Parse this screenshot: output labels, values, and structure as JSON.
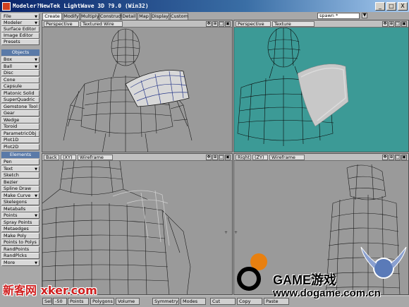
{
  "window": {
    "title": "Modeler?NewTek LightWave 3D ?9.0 (Win32)",
    "controls": [
      "_",
      "□",
      "X"
    ]
  },
  "left_panel": {
    "top_items": [
      {
        "label": "File",
        "dropdown": true
      },
      {
        "label": "Modeler",
        "dropdown": true
      },
      {
        "label": "Surface Editor"
      },
      {
        "label": "Image Editor"
      },
      {
        "label": "Presets"
      }
    ],
    "objects_header": "Objects",
    "objects": [
      {
        "label": "Box",
        "dropdown": true
      },
      {
        "label": "Ball",
        "dropdown": true
      },
      {
        "label": "Disc"
      },
      {
        "label": "Cone"
      },
      {
        "label": "Capsule"
      },
      {
        "label": "Platonic Solid"
      },
      {
        "label": "SuperQuadric"
      },
      {
        "label": "Gemstone Tool"
      },
      {
        "label": "Gear"
      },
      {
        "label": "Wedge"
      },
      {
        "label": "Toroid"
      },
      {
        "label": "ParametricObj"
      },
      {
        "label": "Plot1D"
      },
      {
        "label": "Plot2D"
      }
    ],
    "elements_header": "Elements",
    "elements": [
      {
        "label": "Pen"
      },
      {
        "label": "Text",
        "dropdown": true
      },
      {
        "label": "Sketch"
      },
      {
        "label": "Bezier"
      },
      {
        "label": "Spline Draw"
      },
      {
        "label": "Make Curve",
        "dropdown": true
      },
      {
        "label": "Skelegons"
      },
      {
        "label": "Metaballs"
      },
      {
        "label": "Points",
        "dropdown": true
      },
      {
        "label": "Spray Points"
      },
      {
        "label": "Metaedges"
      },
      {
        "label": "Make Poly"
      },
      {
        "label": "Points to Polys"
      },
      {
        "label": "RandPoints"
      },
      {
        "label": "RandPlcks"
      },
      {
        "label": "More",
        "dropdown": true
      }
    ]
  },
  "tabs": [
    "Create",
    "Modify",
    "Multiply",
    "Construct",
    "Detail",
    "Map",
    "Display",
    "Custom"
  ],
  "active_tab": "Create",
  "layer_selector": "spawn *",
  "viewports": [
    {
      "view": "Perspective",
      "mode": "Textured Wire",
      "background": "#9a9a9a"
    },
    {
      "view": "Perspective",
      "mode": "Texture",
      "background": "#3c9a96"
    },
    {
      "view": "Back",
      "axis": "(XY)",
      "mode": "Wireframe",
      "background": "#9a9a9a"
    },
    {
      "view": "Right",
      "axis": "(ZY)",
      "mode": "Wireframe",
      "background": "#9a9a9a"
    }
  ],
  "viewport_icons": [
    "✥",
    "⊕",
    "□",
    "▣"
  ],
  "bottom_bar": [
    "Sel",
    "-50",
    "Points",
    "Polygons",
    "Volume",
    "Symmetry",
    "Modes",
    "Cut",
    "Copy",
    "Paste"
  ],
  "watermarks": {
    "left": "新客网 xker.com",
    "right_top": "GAME游戏",
    "right_bottom": "www.dogame.com.cn"
  },
  "colors": {
    "viewport_gray": "#9a9a9a",
    "viewport_teal": "#3c9a96",
    "header_blue": "#5a7aa8",
    "titlebar": "#0a246a"
  }
}
